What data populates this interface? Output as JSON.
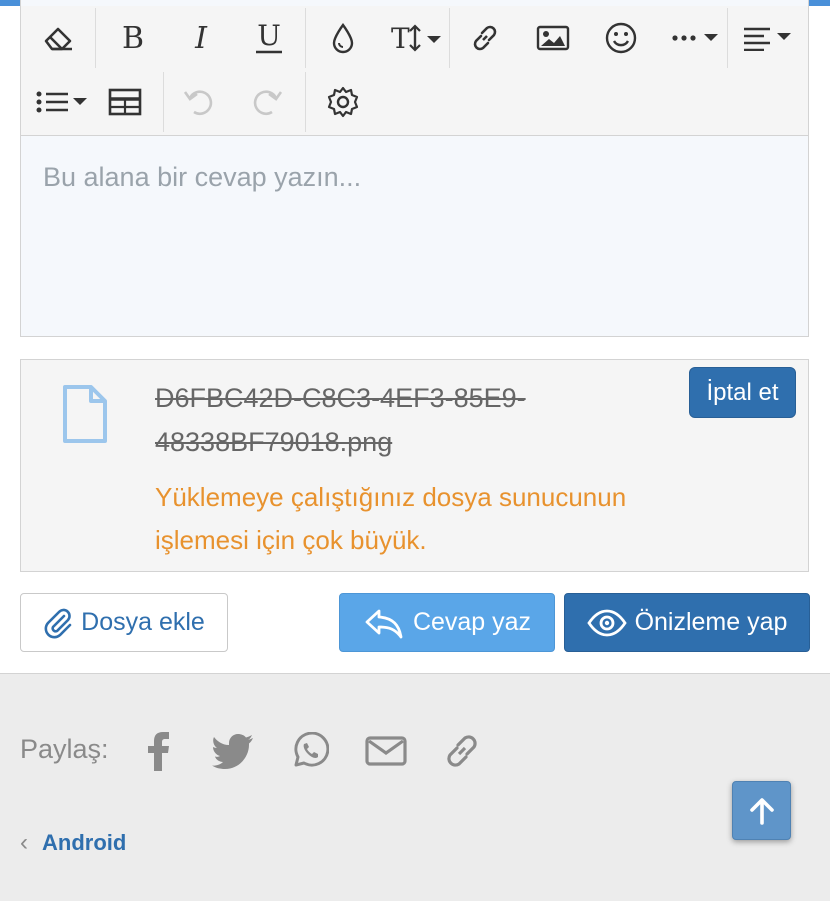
{
  "editor": {
    "placeholder": "Bu alana bir cevap yazın...",
    "toolbar": {
      "buttons": [
        "eraser-icon",
        "bold-icon",
        "italic-icon",
        "underline-icon",
        "drop-icon",
        "text-size-icon",
        "link-icon",
        "image-icon",
        "smile-icon",
        "more-icon",
        "align-icon",
        "list-icon",
        "table-icon",
        "undo-icon",
        "redo-icon",
        "gear-icon"
      ]
    }
  },
  "upload": {
    "filename_line1": "D6FBC42D-C8C3-4EF3-85E9-",
    "filename_line2": "48338BF79018.png",
    "error_line1": "Yüklemeye çalıştığınız dosya sunucunun",
    "error_line2": "işlemesi için çok büyük.",
    "cancel_label": "İptal et"
  },
  "actions": {
    "attach_label": "Dosya ekle",
    "reply_label": "Cevap yaz",
    "preview_label": "Önizleme yap"
  },
  "footer": {
    "share_label": "Paylaş:",
    "share_icons": [
      "facebook-icon",
      "twitter-icon",
      "whatsapp-icon",
      "email-icon",
      "link-icon"
    ],
    "breadcrumb_label": "Android"
  },
  "colors": {
    "accent": "#2f6fae",
    "reply_button": "#5aa6e8",
    "error_text": "#e8922e",
    "top_bar": "#4a90d9"
  }
}
